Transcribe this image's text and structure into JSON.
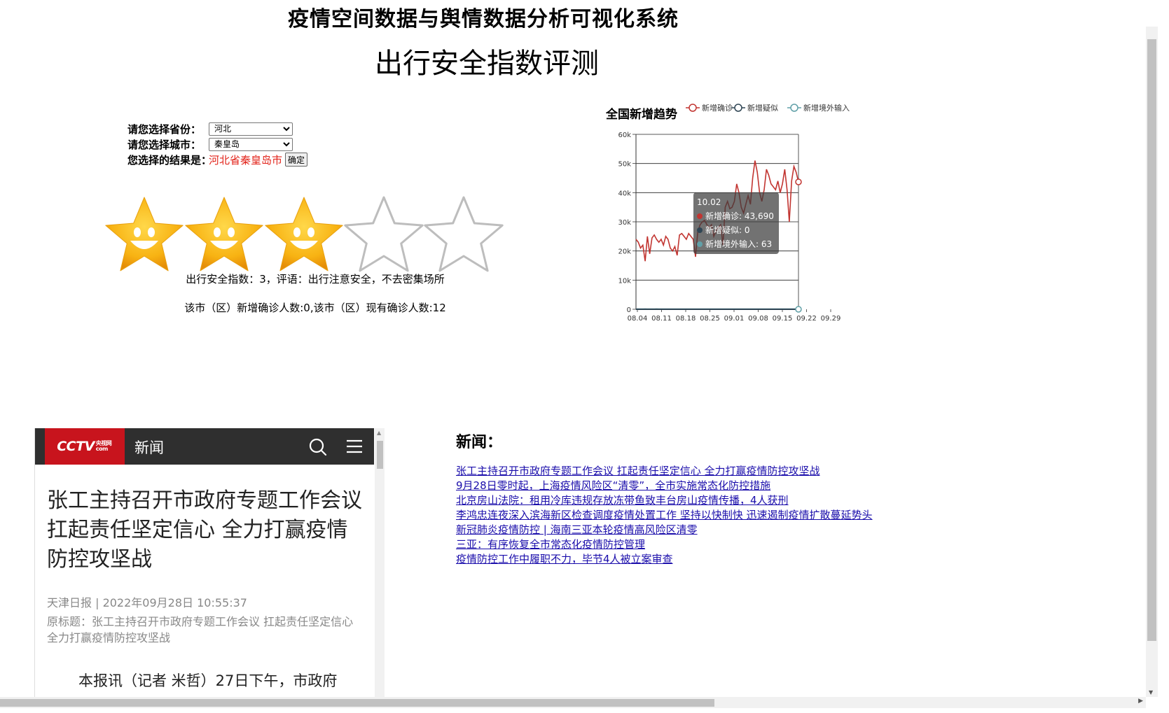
{
  "header": {
    "system_title": "疫情空间数据与舆情数据分析可视化系统",
    "page_title": "出行安全指数评测"
  },
  "selector": {
    "province_label": "请您选择省份：",
    "province_value": "河北",
    "city_label": "请您选择城市：",
    "city_value": "秦皇岛",
    "result_label": "您选择的结果是：",
    "result_value": "河北省秦皇岛市",
    "confirm_label": "确定"
  },
  "rating": {
    "stars_filled": 3,
    "stars_total": 5,
    "summary": "出行安全指数：3，评语：出行注意安全，不去密集场所",
    "counts": "该市（区）新增确诊人数:0,该市（区）现有确诊人数:12"
  },
  "colors": {
    "confirmed": "#c23531",
    "suspected": "#2f4554",
    "imported": "#61a0a8",
    "link": "#1a0dab",
    "result_red": "#e2231a",
    "cctv_red": "#c8141d"
  },
  "chart_data": {
    "type": "line",
    "title": "全国新增趋势",
    "x_ticks": [
      "08.04",
      "08.11",
      "08.18",
      "08.25",
      "09.01",
      "09.08",
      "09.15",
      "09.22",
      "09.29"
    ],
    "y_ticks": [
      "0",
      "10k",
      "20k",
      "30k",
      "40k",
      "50k",
      "60k"
    ],
    "ylim": [
      0,
      60000
    ],
    "grid": true,
    "legend_position": "top",
    "series": [
      {
        "name": "新增确诊",
        "values": [
          24000,
          23000,
          21000,
          22000,
          16500,
          25000,
          19000,
          24500,
          25500,
          24000,
          23000,
          24000,
          22000,
          25000,
          24000,
          21000,
          20000,
          21500,
          18500,
          25500,
          26000,
          25000,
          24000,
          26000,
          25000,
          24000,
          18000,
          26500,
          29000,
          30000,
          30500,
          29000,
          28000,
          29000,
          25000,
          27000,
          28000,
          29000,
          22000,
          35000,
          37000,
          34500,
          35000,
          37000,
          43000,
          40000,
          35000,
          33000,
          36000,
          39000,
          36000,
          45000,
          51000,
          47000,
          40000,
          37000,
          41000,
          48000,
          46000,
          43000,
          42000,
          41000,
          44000,
          40000,
          43000,
          48000,
          41000,
          30000,
          44000,
          49000,
          47000,
          43690
        ]
      },
      {
        "name": "新增疑似",
        "values": [
          0,
          0,
          0,
          0,
          0,
          0,
          0,
          0,
          0,
          0,
          0,
          0,
          0,
          0,
          0,
          0,
          0,
          0,
          0,
          0,
          0,
          0,
          0,
          0,
          0,
          0,
          0,
          0,
          0,
          0,
          0,
          0,
          0,
          0,
          0,
          0,
          0,
          0,
          0,
          0,
          0,
          0,
          0,
          0,
          0,
          0,
          0,
          0,
          0,
          0,
          0,
          0,
          0,
          0,
          0,
          0,
          0,
          0,
          0,
          0,
          0,
          0,
          0,
          0,
          0,
          0,
          0,
          0,
          0,
          0,
          0,
          0
        ]
      },
      {
        "name": "新增境外输入",
        "values": [
          90,
          80,
          70,
          75,
          85,
          60,
          65,
          70,
          80,
          90,
          70,
          60,
          75,
          80,
          70,
          65,
          60,
          70,
          80,
          75,
          70,
          65,
          60,
          70,
          80,
          75,
          70,
          65,
          60,
          70,
          80,
          75,
          70,
          65,
          60,
          70,
          80,
          75,
          70,
          65,
          60,
          70,
          80,
          75,
          70,
          65,
          60,
          70,
          80,
          75,
          70,
          65,
          60,
          70,
          80,
          75,
          70,
          65,
          60,
          70,
          80,
          75,
          70,
          65,
          60,
          70,
          80,
          75,
          70,
          65,
          60,
          63
        ]
      }
    ],
    "tooltip": {
      "date": "10.02",
      "lines": [
        "新增确诊: 43,690",
        "新增疑似: 0",
        "新增境外输入: 63"
      ]
    }
  },
  "embedded_article": {
    "brand": "CCTV",
    "brand_suffix": "央视网 com",
    "section": "新闻",
    "title": "张工主持召开市政府专题工作会议 扛起责任坚定信心 全力打赢疫情防控攻坚战",
    "meta": "天津日报 | 2022年09月28日 10:55:37",
    "original_title": "原标题：张工主持召开市政府专题工作会议 扛起责任坚定信心 全力打赢疫情防控攻坚战",
    "body_start": "本报讯（记者 米哲）27日下午，市政府"
  },
  "news": {
    "heading": "新闻：",
    "links": [
      "张工主持召开市政府专题工作会议 扛起责任坚定信心 全力打赢疫情防控攻坚战",
      "9月28日零时起，上海疫情风险区“清零”，全市实施常态化防控措施",
      "北京房山法院：租用冷库违规存放冻带鱼致丰台房山疫情传播，4人获刑",
      "李鸿忠连夜深入滨海新区检查调度疫情处置工作 坚持以快制快 迅速遏制疫情扩散蔓延势头",
      "新冠肺炎疫情防控 | 海南三亚本轮疫情高风险区清零",
      "三亚：有序恢复全市常态化疫情防控管理",
      "疫情防控工作中履职不力，毕节4人被立案审查"
    ]
  }
}
